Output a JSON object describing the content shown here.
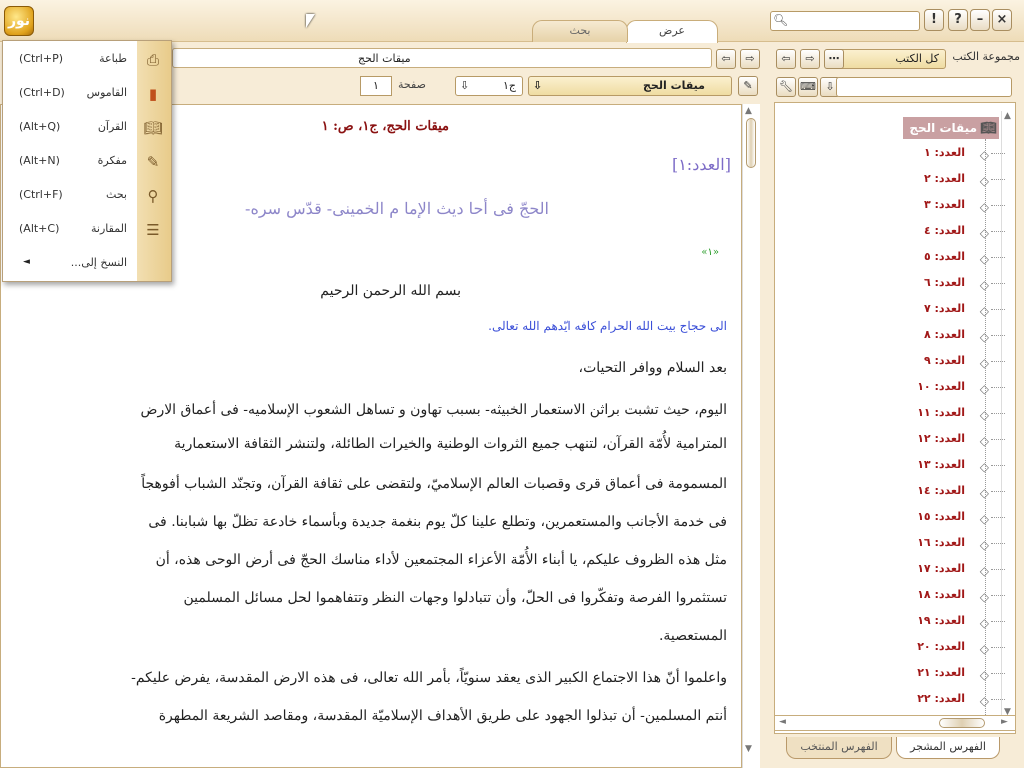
{
  "toolbar": {
    "logo_text": "نور",
    "tabs": [
      {
        "label": "عرض",
        "active": true
      },
      {
        "label": "بحث",
        "active": false
      }
    ],
    "help_label": "?",
    "info_label": "!",
    "minimize_label": "–",
    "close_label": "×"
  },
  "menu": {
    "items": [
      {
        "label": "طباعة",
        "shortcut": "(Ctrl+P)",
        "icon": "printer-icon"
      },
      {
        "label": "القاموس",
        "shortcut": "(Ctrl+D)",
        "icon": "dictionary-icon"
      },
      {
        "label": "القرآن",
        "shortcut": "(Alt+Q)",
        "icon": "quran-icon"
      },
      {
        "label": "مفكرة",
        "shortcut": "(Alt+N)",
        "icon": "notepad-icon"
      },
      {
        "label": "بحث",
        "shortcut": "(Ctrl+F)",
        "icon": "search-icon"
      },
      {
        "label": "المقارنة",
        "shortcut": "(Alt+C)",
        "icon": "compare-icon"
      },
      {
        "label": "النسخ إلى...",
        "shortcut": "",
        "icon": "submenu-arrow-icon"
      }
    ]
  },
  "navigation": {
    "breadcrumb": "ميقات الحج",
    "book": "ميقات الحج",
    "volume": "ج۱",
    "page_label": "صفحة",
    "page": "۱"
  },
  "content": {
    "page_title": "ميقات الحج، ج۱، ص: ۱",
    "issue_title": "[العدد:۱]",
    "heading": "الحجّ فى أحا ديث الإما م الخمينى- قدّس سره-",
    "footnote_marker": "«۱»",
    "basmala": "بسم الله الرحمن الرحيم",
    "greeting": "الى حجاج بيت الله الحرام كافه ايّدهم الله تعالى.",
    "paragraphs": [
      "بعد السلام ووافر التحيات،",
      "اليوم، حيث تشبت براثن الاستعمار الخبيثه- بسبب تهاون و تساهل الشعوب الإسلاميه- فى أعماق الارض",
      "المترامية لأُمّة القرآن، لتنهب جميع الثروات الوطنية والخيرات الطائلة، ولتنشر الثقافة الاستعمارية",
      "المسمومة فى أعماق قرى وقصبات العالم الإسلاميّ، ولتقضى على ثقافة القرآن، وتجنّد الشباب أفوهجاً",
      "فى خدمة الأجانب والمستعمرين، وتطلع علينا كلّ يوم بنغمة جديدة وبأسماء خادعة تظلّ بها شبابنا. فى",
      "مثل هذه الظروف عليكم، يا أبناء الأُمّة الأعزاء المجتمعين لأداء مناسك الحجّ فى أرض الوحى هذه، أن",
      "تستثمروا الفرصة وتفكّروا فى الحلّ، وأن تتبادلوا وجهات النظر وتتفاهموا لحل مسائل المسلمين",
      "المستعصية.",
      "واعلموا أنّ هذا الاجتماع الكبير الذى يعقد سنويّاً، بأمر الله تعالى، فى هذه الارض المقدسة، يفرض عليكم-",
      "أنتم المسلمين- أن تبذلوا الجهود على طريق الأهداف الإسلاميّة المقدسة، ومقاصد الشريعة المطهرة"
    ]
  },
  "sidebar": {
    "collection_label": "مجموعة الكتب",
    "collection_value": "كل الكتب",
    "tree_root": "ميقات الحج",
    "tree_items": [
      "العدد: ۱",
      "العدد: ۲",
      "العدد: ۳",
      "العدد: ٤",
      "العدد: ٥",
      "العدد: ٦",
      "العدد: ۷",
      "العدد: ۸",
      "العدد: ۹",
      "العدد: ۱۰",
      "العدد: ۱۱",
      "العدد: ۱۲",
      "العدد: ۱۳",
      "العدد: ۱٤",
      "العدد: ۱٥",
      "العدد: ۱٦",
      "العدد: ۱۷",
      "العدد: ۱۸",
      "العدد: ۱۹",
      "العدد: ۲۰",
      "العدد: ۲۱",
      "العدد: ۲۲"
    ],
    "bottom_tabs": [
      {
        "label": "الفهرس المشجر",
        "active": true
      },
      {
        "label": "الفهرس المنتخب",
        "active": false
      }
    ]
  }
}
